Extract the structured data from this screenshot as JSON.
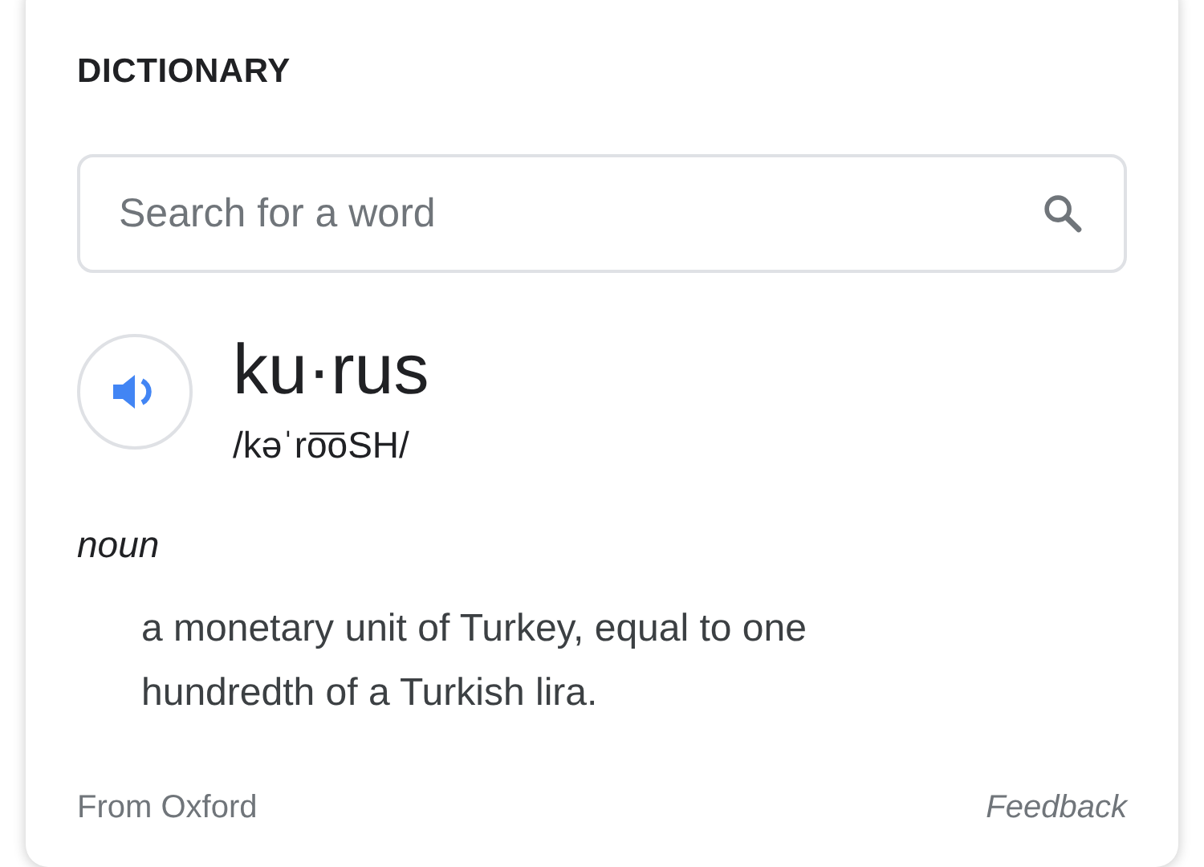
{
  "card": {
    "title": "DICTIONARY",
    "search": {
      "placeholder": "Search for a word"
    },
    "entry": {
      "word": "ku·rus",
      "pronunciation": "/kəˈro͞oSH/"
    },
    "senses": [
      {
        "part_of_speech": "noun",
        "definitions": [
          "a monetary unit of Turkey, equal to one hundredth of a Turkish lira."
        ]
      }
    ],
    "footer": {
      "source": "From Oxford",
      "feedback": "Feedback"
    }
  }
}
